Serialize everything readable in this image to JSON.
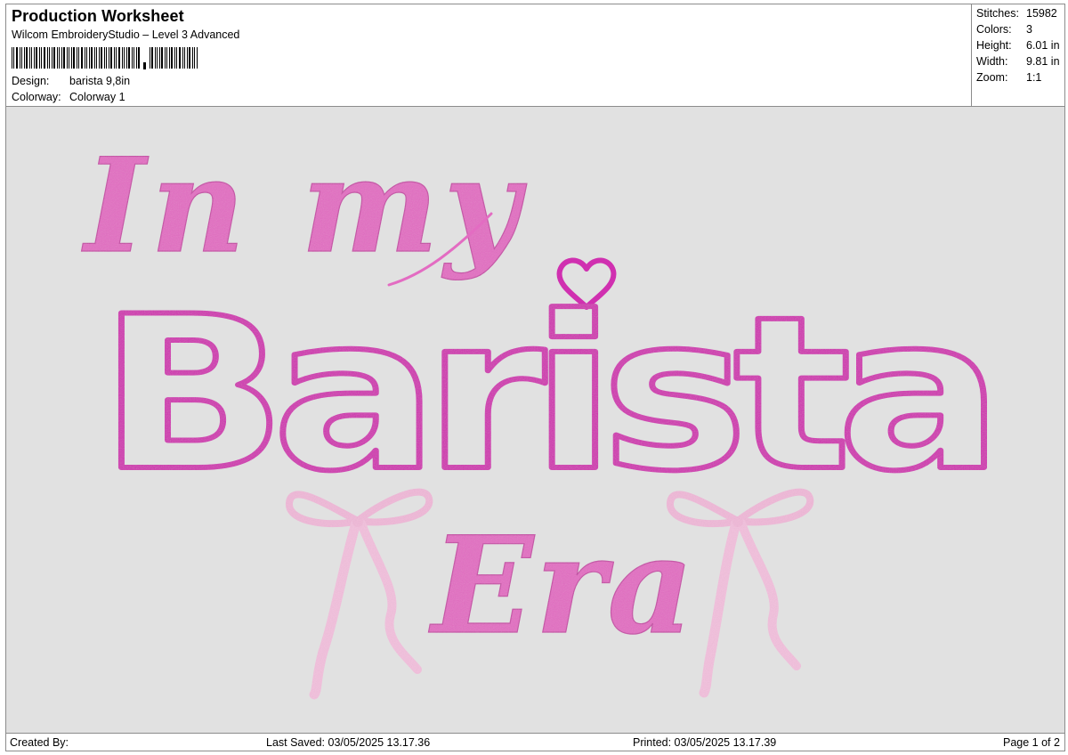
{
  "header": {
    "title": "Production Worksheet",
    "software": "Wilcom EmbroideryStudio – Level 3 Advanced",
    "design_label": "Design:",
    "design_value": "barista 9,8in",
    "colorway_label": "Colorway:",
    "colorway_value": "Colorway 1"
  },
  "stats": {
    "stitches_label": "Stitches:",
    "stitches_value": "15982",
    "colors_label": "Colors:",
    "colors_value": "3",
    "height_label": "Height:",
    "height_value": "6.01 in",
    "width_label": "Width:",
    "width_value": "9.81 in",
    "zoom_label": "Zoom:",
    "zoom_value": "1:1"
  },
  "design": {
    "line1": "In my",
    "line2": "Barista",
    "line3": "Era",
    "colors": {
      "script_pink": "#e36cc2",
      "outline_magenta": "#d030b0",
      "bow_pink": "#f0b8d8",
      "background": "#e1e1e1"
    }
  },
  "footer": {
    "created_by": "Created By:",
    "last_saved": "Last Saved: 03/05/2025 13.17.36",
    "printed": "Printed: 03/05/2025 13.17.39",
    "page": "Page 1 of 2"
  }
}
